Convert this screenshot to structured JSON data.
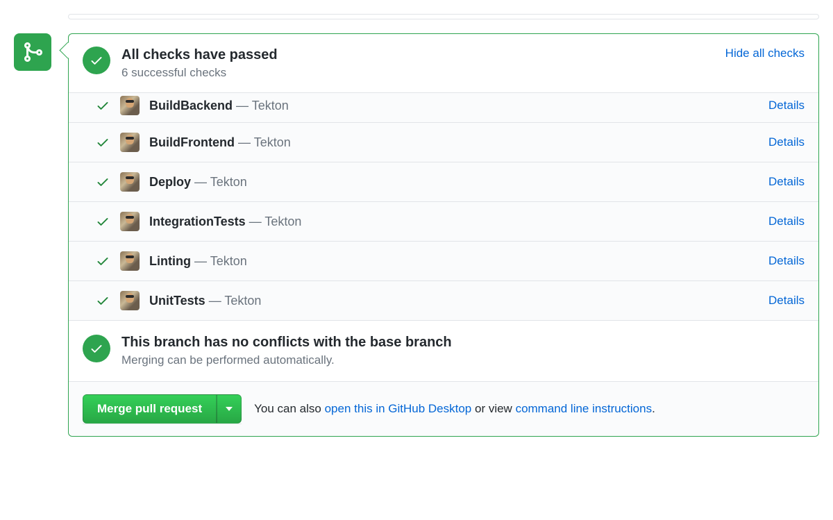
{
  "header": {
    "title": "All checks have passed",
    "subtitle": "6 successful checks",
    "hide_link": "Hide all checks"
  },
  "checks": [
    {
      "name": "BuildBackend",
      "provider": "Tekton",
      "details": "Details"
    },
    {
      "name": "BuildFrontend",
      "provider": "Tekton",
      "details": "Details"
    },
    {
      "name": "Deploy",
      "provider": "Tekton",
      "details": "Details"
    },
    {
      "name": "IntegrationTests",
      "provider": "Tekton",
      "details": "Details"
    },
    {
      "name": "Linting",
      "provider": "Tekton",
      "details": "Details"
    },
    {
      "name": "UnitTests",
      "provider": "Tekton",
      "details": "Details"
    }
  ],
  "conflicts": {
    "title": "This branch has no conflicts with the base branch",
    "subtitle": "Merging can be performed automatically."
  },
  "merge": {
    "button": "Merge pull request",
    "hint_prefix": "You can also ",
    "desktop_link": "open this in GitHub Desktop",
    "hint_mid": " or view ",
    "cli_link": "command line instructions",
    "hint_suffix": "."
  }
}
